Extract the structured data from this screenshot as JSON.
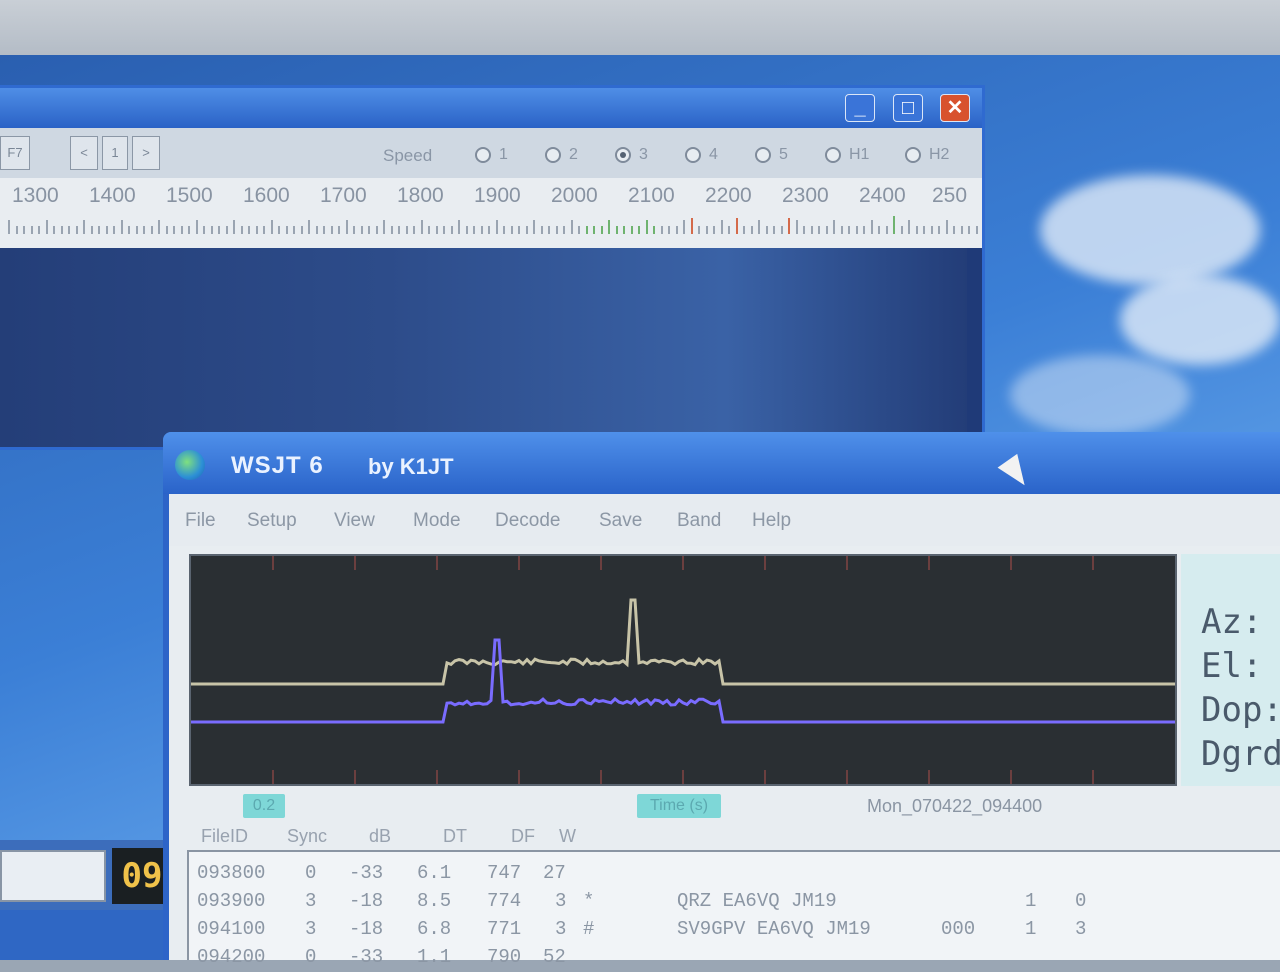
{
  "spectrum_window": {
    "controls": {
      "min": "_",
      "max": "□",
      "close": "✕"
    },
    "toolbar": {
      "left_button": "F7",
      "nav_prev": "<",
      "nav_mid": "1",
      "nav_next": ">"
    },
    "speed": {
      "label": "Speed",
      "options": [
        "1",
        "2",
        "3",
        "4",
        "5",
        "H1",
        "H2"
      ],
      "selected": "3"
    },
    "freq_labels": [
      "1300",
      "1400",
      "1500",
      "1600",
      "1700",
      "1800",
      "1900",
      "2000",
      "2100",
      "2200",
      "2300",
      "2400",
      "250"
    ]
  },
  "wsjt": {
    "title": "WSJT 6",
    "by": "by K1JT",
    "menu": [
      "File",
      "Setup",
      "View",
      "Mode",
      "Decode",
      "Save",
      "Band",
      "Help"
    ],
    "info_labels": [
      "Az:",
      "El:",
      "Dop:",
      "Dgrd"
    ],
    "status": {
      "left": "0.2",
      "time_label": "Time (s)",
      "date": "Mon_070422_094400"
    },
    "columns": [
      "FileID",
      "Sync",
      "dB",
      "DT",
      "DF",
      "W"
    ],
    "rows": [
      {
        "file": "093800",
        "sync": "0",
        "db": "-33",
        "dt": "6.1",
        "df": "747",
        "w": "27",
        "flag": "",
        "msg": "",
        "extra1": "",
        "extra2": "",
        "extra3": ""
      },
      {
        "file": "093900",
        "sync": "3",
        "db": "-18",
        "dt": "8.5",
        "df": "774",
        "w": "3",
        "flag": "*",
        "msg": "QRZ EA6VQ JM19",
        "extra1": "",
        "extra2": "1",
        "extra3": "0"
      },
      {
        "file": "094100",
        "sync": "3",
        "db": "-18",
        "dt": "6.8",
        "df": "771",
        "w": "3",
        "flag": "#",
        "msg": "SV9GPV EA6VQ JM19",
        "extra1": "000",
        "extra2": "1",
        "extra3": "3"
      },
      {
        "file": "094200",
        "sync": "0",
        "db": "-33",
        "dt": "1.1",
        "df": "790",
        "w": "52",
        "flag": "",
        "msg": "",
        "extra1": "",
        "extra2": "",
        "extra3": ""
      }
    ],
    "chart": {
      "grey_series": "flat low level, raised plateau between about 26% and 54% of the width with a sharp spike near 45%",
      "blue_series": "flat low level, raised plateau between about 26% and 54% of the width with a spike near 31%"
    }
  },
  "fragment": {
    "clock": "09"
  },
  "colors": {
    "grey_trace": "#c8c4a8",
    "blue_trace": "#7a6cff",
    "plot_bg": "#2a2f33",
    "accent": "#2d64c8"
  }
}
